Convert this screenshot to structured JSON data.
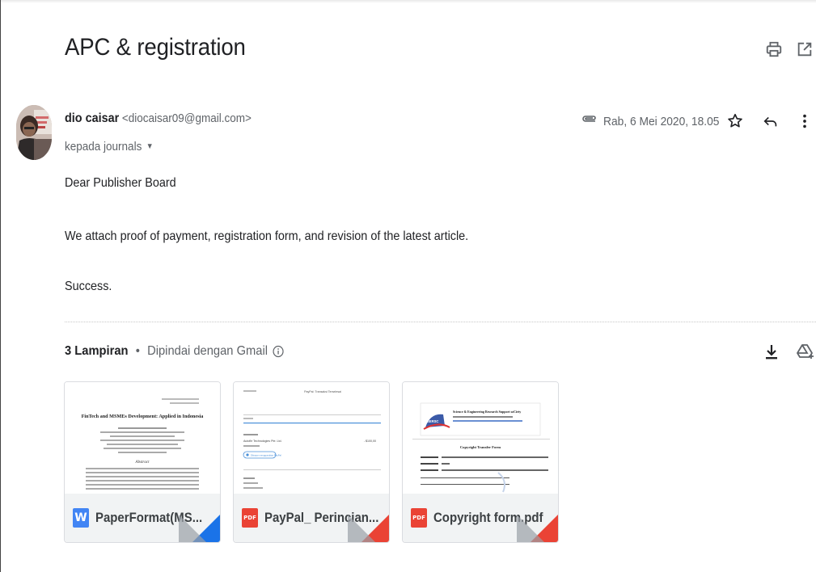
{
  "email": {
    "subject": "APC & registration",
    "sender": {
      "name": "dio caisar",
      "email": "<diocaisar09@gmail.com>"
    },
    "recipient": "kepada journals",
    "date": "Rab, 6 Mei 2020, 18.05",
    "body": {
      "line_1": "Dear Publisher Board",
      "line_2": "We attach proof of payment, registration form, and revision of the latest article.",
      "line_3": "Success."
    }
  },
  "attachments": {
    "count_label": "3 Lampiran",
    "separator": "•",
    "scan_label": "Dipindai dengan Gmail",
    "files": [
      {
        "name": "PaperFormat(MS...",
        "badge": "W",
        "type": "word"
      },
      {
        "name": "PayPal_ Perincian...",
        "badge": "PDF",
        "type": "pdf"
      },
      {
        "name": "Copyright form.pdf",
        "badge": "PDF",
        "type": "pdf"
      }
    ]
  },
  "previews": {
    "paper": {
      "title": "FinTech and MSMEs Development: Applied in Indonesia",
      "section": "Abstract"
    },
    "paypal": {
      "header": "PayPal: Transaksi Terselesai",
      "payee": "Autofle Technologies Pte. Ltd.",
      "amount": "- $100,00",
      "button": "Dibayar menggunakan PayPal"
    },
    "copyright": {
      "org": "Science & Engineering Research Support soCiety",
      "logo": "SERSC",
      "form_title": "Copyright Transfer Form"
    }
  },
  "colors": {
    "word_blue": "#4285f4",
    "pdf_red": "#ea4335",
    "muted": "#5f6368",
    "text": "#202124"
  },
  "icons": {
    "print": "print-icon",
    "open": "open-in-new-window-icon",
    "attachment": "paperclip-icon",
    "star": "star-icon",
    "reply": "reply-icon",
    "more": "more-vertical-icon",
    "download": "download-all-icon",
    "drive": "add-to-drive-icon",
    "info": "info-icon"
  }
}
